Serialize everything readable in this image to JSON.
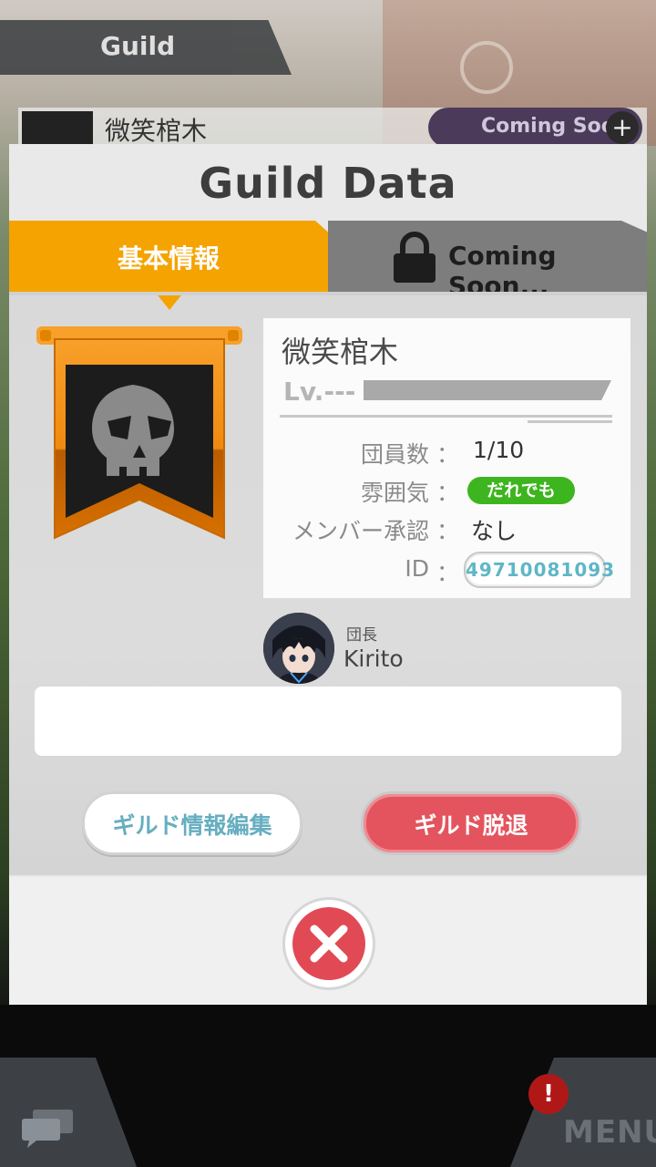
{
  "background": {
    "guild_tab_label": "Guild",
    "row_guild_name": "微笑棺木",
    "coming_soon_label": "Coming Soon",
    "plus_label": "+"
  },
  "hud": {
    "menu_label": "MENU",
    "alert_label": "!"
  },
  "dialog": {
    "title": "Guild Data",
    "tabs": [
      {
        "label": "基本情報",
        "active": true
      },
      {
        "label": "Coming Soon...",
        "active": false,
        "icon": "lock-icon"
      }
    ],
    "guild": {
      "name": "微笑棺木",
      "level_label": "Lv.---",
      "members_label": "団員数",
      "members_value": "1/10",
      "mood_label": "雰囲気",
      "mood_value": "だれでも",
      "approval_label": "メンバー承認",
      "approval_value": "なし",
      "id_label": "ID",
      "id_value": "49710081093",
      "colon": "："
    },
    "leader": {
      "role": "団長",
      "name": "Kirito"
    },
    "description": "",
    "buttons": {
      "edit": "ギルド情報編集",
      "leave": "ギルド脱退"
    }
  },
  "colors": {
    "accent_orange": "#f5a300",
    "mood_green": "#3db51e",
    "leave_red": "#e3545f",
    "id_teal": "#5fb6c6"
  }
}
